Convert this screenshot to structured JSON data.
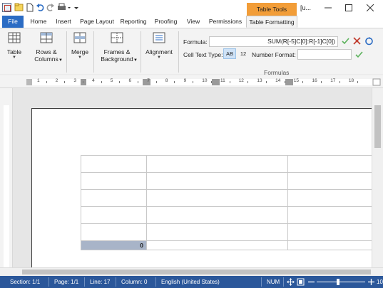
{
  "titlebar": {
    "context_group": "Table Tools",
    "title": "[u..."
  },
  "tabs": {
    "file": "File",
    "home": "Home",
    "insert": "Insert",
    "page_layout": "Page Layout",
    "reporting": "Reporting",
    "proofing": "Proofing",
    "view": "View",
    "permissions": "Permissions",
    "table_formatting": "Table Formatting"
  },
  "ribbon": {
    "table": "Table",
    "rows_columns_1": "Rows &",
    "rows_columns_2": "Columns",
    "merge": "Merge",
    "frames_bg_1": "Frames &",
    "frames_bg_2": "Background",
    "alignment": "Alignment",
    "formula_label": "Formula:",
    "formula_value": "SUM(R[-5]C[0]:R[-1]C[0])",
    "cell_text_type_label": "Cell Text Type:",
    "cell_type_ab": "AB",
    "cell_type_12": "12",
    "number_format_label": "Number Format:",
    "group_label": "Formulas"
  },
  "ruler": {
    "numbers": [
      "1",
      "2",
      "3",
      "4",
      "5",
      "6",
      "7",
      "8",
      "9",
      "10",
      "11",
      "12",
      "13",
      "14",
      "15",
      "16",
      "17",
      "18"
    ]
  },
  "document": {
    "selected_cell_value": "0"
  },
  "status": {
    "section": "Section: 1/1",
    "page": "Page: 1/1",
    "line": "Line: 17",
    "column": "Column: 0",
    "language": "English (United States)",
    "num": "NUM",
    "zoom": "10"
  },
  "colors": {
    "accent": "#2b6cc4",
    "context_tab": "#f29d38",
    "statusbar": "#2b579a",
    "selected_cell": "#a8b4c8"
  }
}
